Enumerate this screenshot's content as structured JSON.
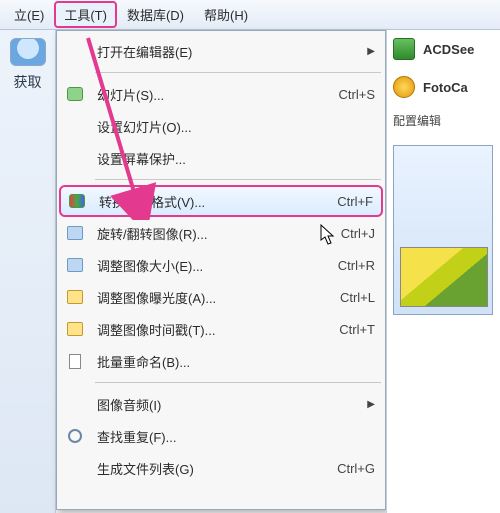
{
  "menubar": {
    "items": [
      {
        "label": "立(E)"
      },
      {
        "label": "工具(T)"
      },
      {
        "label": "数据库(D)"
      },
      {
        "label": "帮助(H)"
      }
    ],
    "active_index": 1
  },
  "leftbar": {
    "label": "获取"
  },
  "right": {
    "app1": "ACDSee",
    "app2": "FotoCa",
    "config": "配置编辑"
  },
  "menu": {
    "items": [
      {
        "label": "打开在编辑器(E)",
        "shortcut": "",
        "arrow": true,
        "icon": ""
      },
      {
        "sep": true
      },
      {
        "label": "幻灯片(S)...",
        "shortcut": "Ctrl+S",
        "arrow": false,
        "icon": "slide"
      },
      {
        "label": "设置幻灯片(O)...",
        "shortcut": "",
        "arrow": false,
        "icon": ""
      },
      {
        "label": "设置屏幕保护...",
        "shortcut": "",
        "arrow": false,
        "icon": ""
      },
      {
        "sep": true
      },
      {
        "label": "转换文件格式(V)...",
        "shortcut": "Ctrl+F",
        "arrow": false,
        "icon": "convert",
        "highlight": true
      },
      {
        "label": "旋转/翻转图像(R)...",
        "shortcut": "Ctrl+J",
        "arrow": false,
        "icon": "rotate"
      },
      {
        "label": "调整图像大小(E)...",
        "shortcut": "Ctrl+R",
        "arrow": false,
        "icon": "resize"
      },
      {
        "label": "调整图像曝光度(A)...",
        "shortcut": "Ctrl+L",
        "arrow": false,
        "icon": "expose"
      },
      {
        "label": "调整图像时间戳(T)...",
        "shortcut": "Ctrl+T",
        "arrow": false,
        "icon": "time"
      },
      {
        "label": "批量重命名(B)...",
        "shortcut": "",
        "arrow": false,
        "icon": "doc"
      },
      {
        "sep": true
      },
      {
        "label": "图像音频(I)",
        "shortcut": "",
        "arrow": true,
        "icon": ""
      },
      {
        "label": "查找重复(F)...",
        "shortcut": "",
        "arrow": false,
        "icon": "find"
      },
      {
        "label": "生成文件列表(G)",
        "shortcut": "Ctrl+G",
        "arrow": false,
        "icon": ""
      }
    ]
  }
}
